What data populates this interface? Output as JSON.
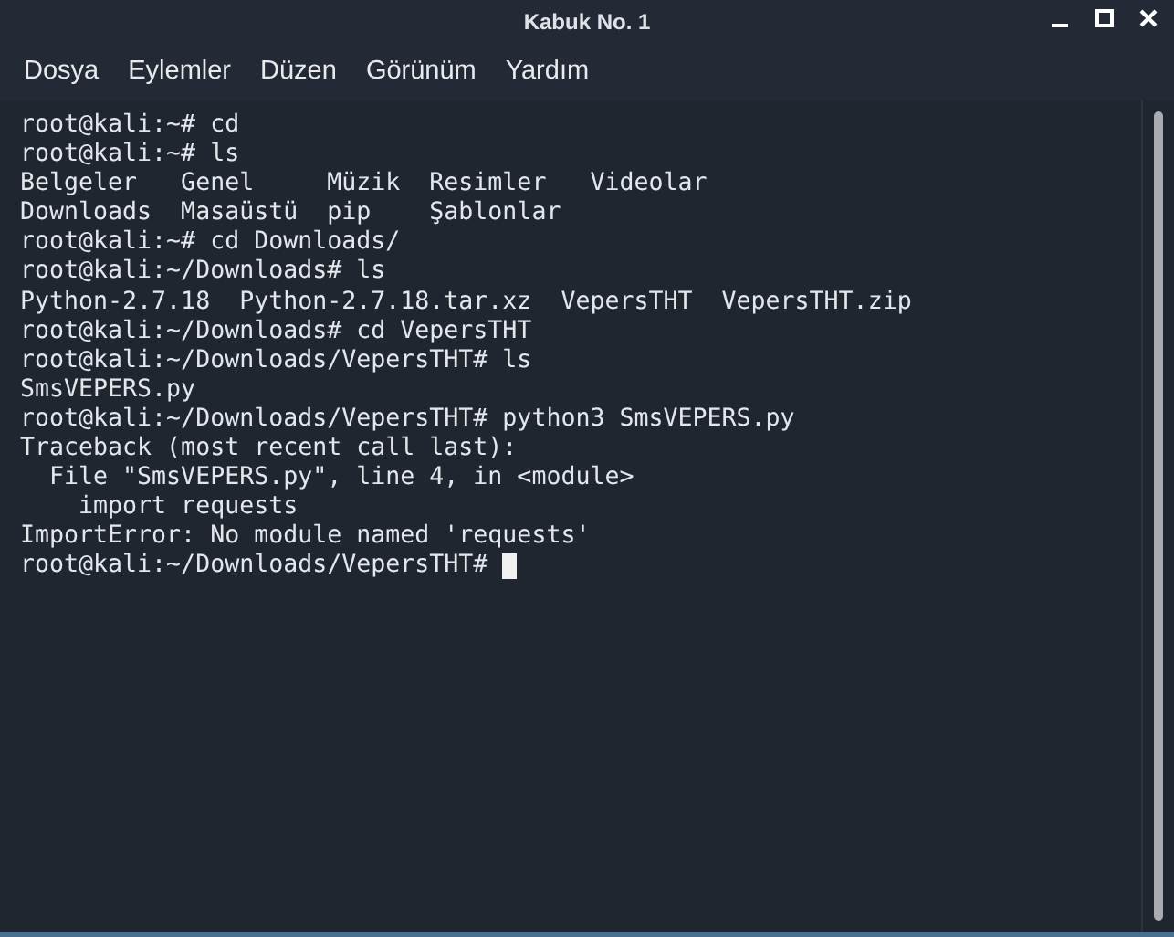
{
  "window": {
    "title": "Kabuk No. 1"
  },
  "menu": [
    {
      "label": "Dosya"
    },
    {
      "label": "Eylemler"
    },
    {
      "label": "Düzen"
    },
    {
      "label": "Görünüm"
    },
    {
      "label": "Yardım"
    }
  ],
  "terminal": {
    "cursor": true,
    "lines": [
      "root@kali:~# cd",
      "root@kali:~# ls",
      "Belgeler   Genel     Müzik  Resimler   Videolar",
      "Downloads  Masaüstü  pip    Şablonlar",
      "root@kali:~# cd Downloads/",
      "root@kali:~/Downloads# ls",
      "Python-2.7.18  Python-2.7.18.tar.xz  VepersTHT  VepersTHT.zip",
      "root@kali:~/Downloads# cd VepersTHT",
      "root@kali:~/Downloads/VepersTHT# ls",
      "SmsVEPERS.py",
      "root@kali:~/Downloads/VepersTHT# python3 SmsVEPERS.py",
      "Traceback (most recent call last):",
      "  File \"SmsVEPERS.py\", line 4, in <module>",
      "    import requests",
      "ImportError: No module named 'requests'",
      "root@kali:~/Downloads/VepersTHT#"
    ]
  }
}
